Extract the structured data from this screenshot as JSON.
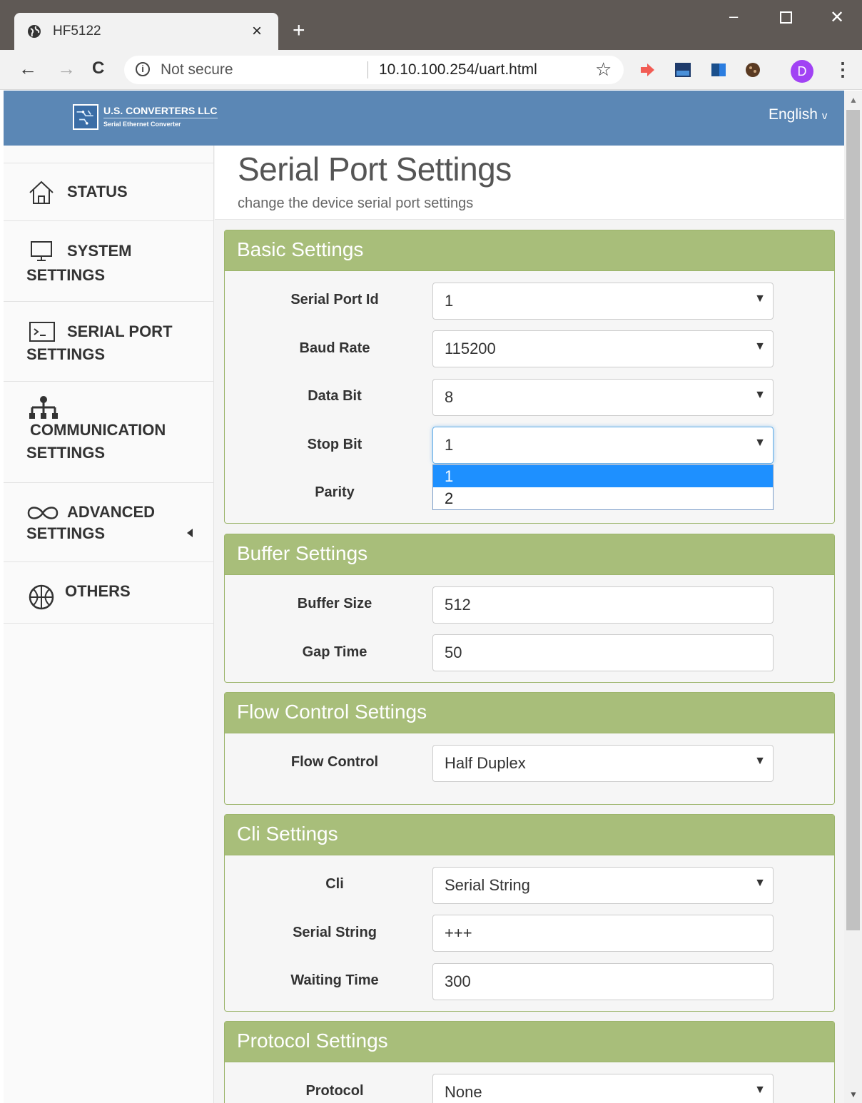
{
  "browser": {
    "tab_title": "HF5122",
    "tab_close": "×",
    "new_tab": "+",
    "url_security": "Not secure",
    "url": "10.10.100.254/uart.html",
    "info_glyph": "i",
    "back": "←",
    "forward": "→",
    "reload": "C",
    "star": "☆",
    "min": "–",
    "close": "✕",
    "avatar_letter": "D",
    "menu": "⋮"
  },
  "header": {
    "logo_name": "U.S. CONVERTERS LLC",
    "logo_sub": "Serial Ethernet Converter",
    "language": "English",
    "lang_caret": "v"
  },
  "sidebar": {
    "status": "STATUS",
    "system_1": "SYSTEM",
    "system_2": "SETTINGS",
    "serial_1": "SERIAL PORT",
    "serial_2": "SETTINGS",
    "comm_1": "COMMUNICATION",
    "comm_2": "SETTINGS",
    "adv_1": "ADVANCED",
    "adv_2": "SETTINGS",
    "others": "OTHERS"
  },
  "page": {
    "title": "Serial Port Settings",
    "subtitle": "change the device serial port settings"
  },
  "basic": {
    "title": "Basic Settings",
    "serial_port_id_label": "Serial Port Id",
    "serial_port_id": "1",
    "baud_rate_label": "Baud Rate",
    "baud_rate": "115200",
    "data_bit_label": "Data Bit",
    "data_bit": "8",
    "stop_bit_label": "Stop Bit",
    "stop_bit": "1",
    "stop_bit_options": [
      "1",
      "2"
    ],
    "parity_label": "Parity"
  },
  "buffer": {
    "title": "Buffer Settings",
    "buffer_size_label": "Buffer Size",
    "buffer_size": "512",
    "gap_time_label": "Gap Time",
    "gap_time": "50"
  },
  "flow": {
    "title": "Flow Control Settings",
    "flow_control_label": "Flow Control",
    "flow_control": "Half Duplex"
  },
  "cli": {
    "title": "Cli Settings",
    "cli_label": "Cli",
    "cli": "Serial String",
    "serial_string_label": "Serial String",
    "serial_string": "+++",
    "waiting_time_label": "Waiting Time",
    "waiting_time": "300"
  },
  "protocol": {
    "title": "Protocol Settings",
    "protocol_label": "Protocol",
    "protocol": "None"
  },
  "colors": {
    "header_bg": "#5b87b5",
    "panel_head": "#a8be7a",
    "dropdown_selected": "#1e90ff"
  }
}
